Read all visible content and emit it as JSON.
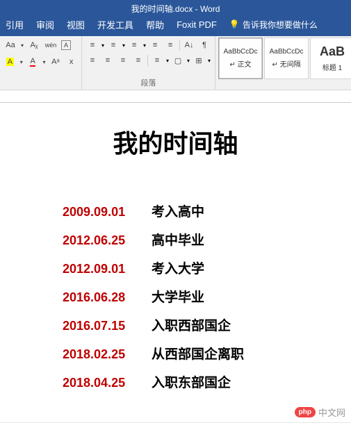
{
  "window": {
    "title": "我的时间轴.docx - Word"
  },
  "tabs": {
    "t0": "引用",
    "t1": "审阅",
    "t2": "视图",
    "t3": "开发工具",
    "t4": "帮助",
    "t5": "Foxit PDF",
    "tellme_icon": "💡",
    "tellme": "告诉我你想要做什么"
  },
  "ribbon": {
    "font": {
      "aa_big": "Aa",
      "clear": "Aᵪ",
      "wen": "wén",
      "box": "A",
      "a_fill": "A",
      "a_color": "A",
      "a_case": "Aᵃ",
      "strike": "x",
      "group_label": ""
    },
    "para": {
      "group_label": "段落",
      "list1": "≡",
      "list2": "≡",
      "list3": "≡",
      "indent_dec": "≡",
      "indent_inc": "≡",
      "sort": "A↓",
      "mark": "¶",
      "align_l": "≡",
      "align_c": "≡",
      "align_r": "≡",
      "align_j": "≡",
      "spacing": "≡",
      "shade": "▢",
      "border": "⊞"
    },
    "styles": {
      "s1_preview": "AaBbCcDc",
      "s1_label": "↵ 正文",
      "s2_preview": "AaBbCcDc",
      "s2_label": "↵ 无间隔",
      "s3_preview": "AaB",
      "s3_label": "标题 1"
    }
  },
  "document": {
    "title": "我的时间轴",
    "rows": [
      {
        "date": "2009.09.01",
        "text": "考入高中"
      },
      {
        "date": "2012.06.25",
        "text": "高中毕业"
      },
      {
        "date": "2012.09.01",
        "text": "考入大学"
      },
      {
        "date": "2016.06.28",
        "text": "大学毕业"
      },
      {
        "date": "2016.07.15",
        "text": "入职西部国企"
      },
      {
        "date": "2018.02.25",
        "text": "从西部国企离职"
      },
      {
        "date": "2018.04.25",
        "text": "入职东部国企"
      }
    ]
  },
  "watermark": {
    "badge": "php",
    "text": "中文网"
  }
}
